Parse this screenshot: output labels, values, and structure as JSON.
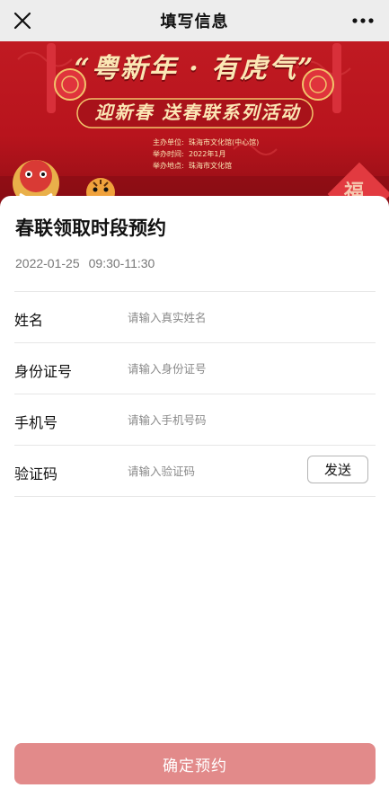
{
  "navbar": {
    "title": "填写信息",
    "close_icon": "close-icon",
    "more_icon": "more-dots-icon"
  },
  "banner": {
    "title": "“粤新年 · 有虎气”",
    "subtitle": "迎新春 送春联系列活动",
    "info": [
      {
        "key": "主办单位:",
        "value": "珠海市文化馆(中心馆)"
      },
      {
        "key": "举办时间:",
        "value": "2022年1月"
      },
      {
        "key": "举办地点:",
        "value": "珠海市文化馆"
      }
    ],
    "fu_char": "福",
    "colors": {
      "background": "#c01a22",
      "text": "#fbe7b5"
    }
  },
  "card": {
    "title": "春联领取时段预约",
    "date": "2022-01-25",
    "time_range": "09:30-11:30"
  },
  "form": {
    "fields": [
      {
        "label": "姓名",
        "placeholder": "请输入真实姓名",
        "value": ""
      },
      {
        "label": "身份证号",
        "placeholder": "请输入身份证号",
        "value": ""
      },
      {
        "label": "手机号",
        "placeholder": "请输入手机号码",
        "value": ""
      },
      {
        "label": "验证码",
        "placeholder": "请输入验证码",
        "value": ""
      }
    ],
    "send_label": "发送"
  },
  "submit": {
    "label": "确定预约",
    "color": "#e28a8a"
  }
}
